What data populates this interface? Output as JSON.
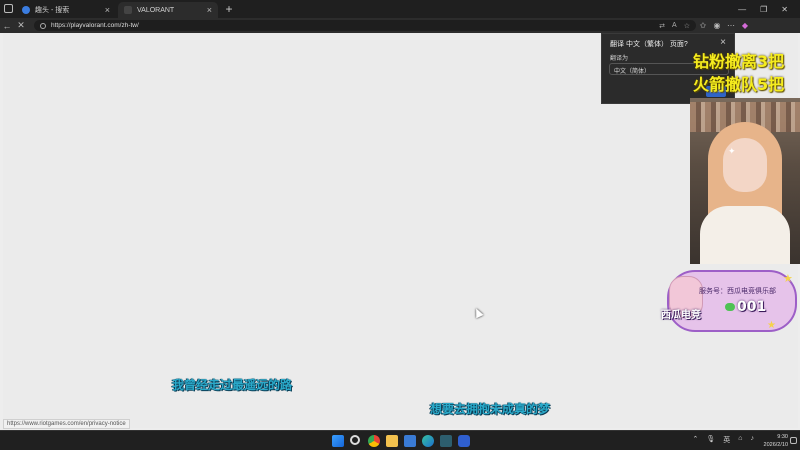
{
  "browser": {
    "tabs": [
      {
        "title": "趣头 - 搜索"
      },
      {
        "title": "VALORANT"
      }
    ],
    "new_tab_label": "+",
    "window_controls": [
      "—",
      "❐",
      "✕"
    ],
    "url": "https://playvalorant.com/zh-tw/",
    "status_url": "https://www.riotgames.com/en/privacy-notice"
  },
  "translate_popup": {
    "title": "翻译 中文（繁体） 页面?",
    "label": "翻译为",
    "selected_language": "中文（简体）",
    "button_label": "翻译"
  },
  "stream_overlay": {
    "top_lines": [
      "钻粉撤离3把",
      "火箭撤队5把"
    ],
    "badge": {
      "club_text": "服务号：西瓜电竞俱乐部",
      "name": "西瓜电竞",
      "number": "001"
    },
    "lyrics": [
      "我曾经走过最遥远的路",
      "想要去拥抱未成真的梦"
    ]
  },
  "taskbar": {
    "time": "9:30",
    "date": "2026/2/10",
    "tray_icons": [
      "chevron-up-icon",
      "microphone-icon",
      "input-language-icon",
      "network-icon",
      "volume-icon"
    ],
    "ime_label": "英"
  },
  "colors": {
    "chrome_bg": "#1f1f1f",
    "page_bg": "#ebebeb",
    "overlay_yellow": "#f5ec1e",
    "lyric_cyan": "#2aa9c9",
    "translate_button": "#2f64c8"
  }
}
